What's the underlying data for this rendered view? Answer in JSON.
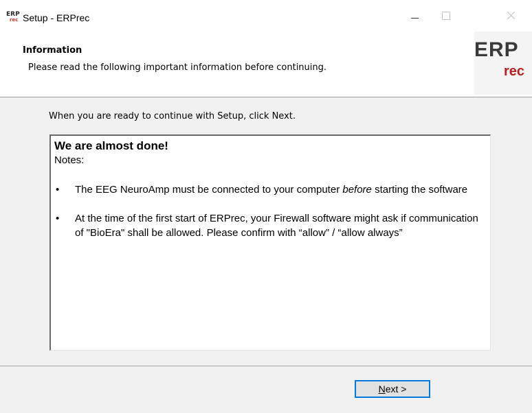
{
  "window": {
    "title": "Setup - ERPrec",
    "icon": "erp-app-icon",
    "icon_text_top": "ERP",
    "icon_text_bottom": "rec"
  },
  "header": {
    "title": "Information",
    "subtitle": "Please read the following important information before continuing.",
    "logo_text_top": "ERP",
    "logo_text_bottom": "rec"
  },
  "body": {
    "prompt": "When you are ready to continue with Setup, click Next.",
    "info": {
      "heading": "We are almost done!",
      "notes_label": "Notes:",
      "bullet_1_pre": "The EEG NeuroAmp must be connected to your computer ",
      "bullet_1_em": "before",
      "bullet_1_post": " starting the software",
      "bullet_2": "At the time of the first start of ERPrec, your Firewall software might ask if communication of \"BioEra\" shall be allowed. Please confirm with “allow” / “allow always”",
      "bullet_symbol": "•"
    }
  },
  "footer": {
    "next_label_underlined": "N",
    "next_label_rest": "ext >"
  },
  "colors": {
    "accent": "#0078d7",
    "logo_red": "#b22222",
    "logo_gray": "#3a3a3a"
  }
}
